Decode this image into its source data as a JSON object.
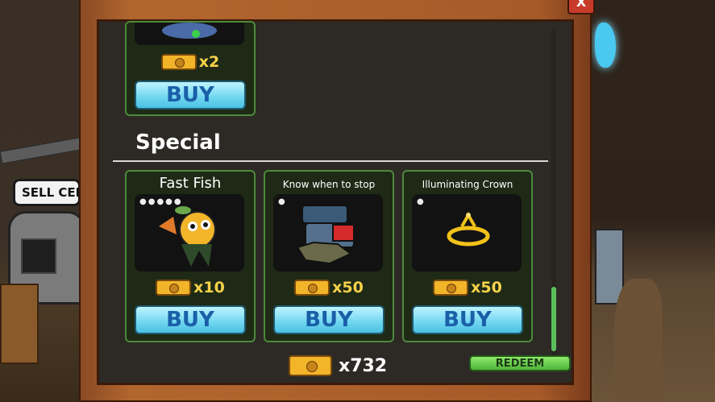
{
  "scene": {
    "sell_sign": "SELL CENT"
  },
  "shop": {
    "close_label": "X",
    "top_item": {
      "price": "x2",
      "buy_label": "BUY"
    },
    "section_title": "Special",
    "items": [
      {
        "title": "Fast Fish",
        "price": "x10",
        "buy_label": "BUY",
        "level_dots": "●●●●●",
        "icon": "fish-icon"
      },
      {
        "title": "Know when to stop",
        "price": "x50",
        "buy_label": "BUY",
        "level_dots": "●",
        "icon": "robot-helmet-icon"
      },
      {
        "title": "Illuminating Crown",
        "price": "x50",
        "buy_label": "BUY",
        "level_dots": "●",
        "icon": "crown-icon"
      }
    ],
    "balance": "x732",
    "redeem_label": "REDEEM"
  },
  "colors": {
    "frame": "#a65a28",
    "panel": "#2d2a26",
    "card_border": "#4c8a3a",
    "buy": "#6fd6f0",
    "coin": "#f2b52a",
    "redeem": "#5bc05a"
  }
}
